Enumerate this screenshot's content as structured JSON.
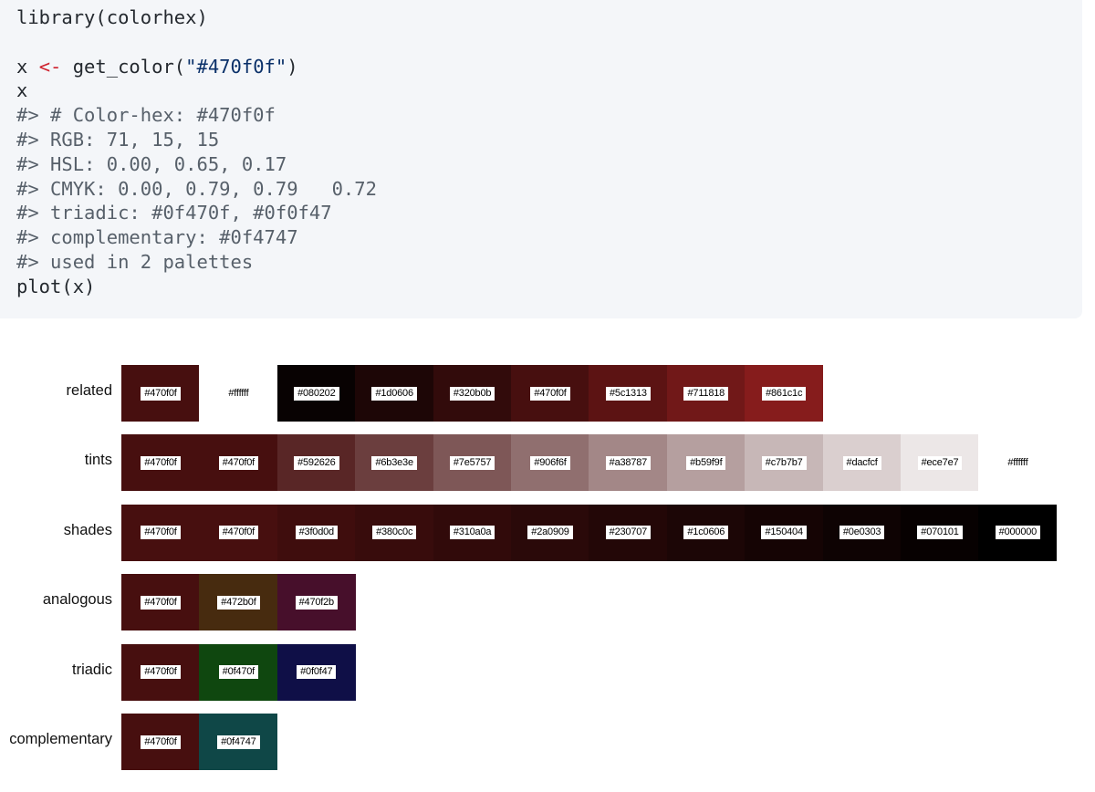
{
  "code": {
    "lines": [
      {
        "text": "library(colorhex)",
        "kind": "code"
      },
      {
        "text": "",
        "kind": "blank"
      },
      {
        "pre": "x ",
        "op": "<-",
        "mid": " get_color(",
        "str": "\"#470f0f\"",
        "post": ")",
        "kind": "assign"
      },
      {
        "text": "x",
        "kind": "code"
      },
      {
        "text": "#> # Color-hex: #470f0f",
        "kind": "comment"
      },
      {
        "text": "#> RGB: 71, 15, 15",
        "kind": "comment"
      },
      {
        "text": "#> HSL: 0.00, 0.65, 0.17",
        "kind": "comment"
      },
      {
        "text": "#> CMYK: 0.00, 0.79, 0.79   0.72",
        "kind": "comment"
      },
      {
        "text": "#> triadic: #0f470f, #0f0f47",
        "kind": "comment"
      },
      {
        "text": "#> complementary: #0f4747",
        "kind": "comment"
      },
      {
        "text": "#> used in 2 palettes",
        "kind": "comment"
      },
      {
        "text": "plot(x)",
        "kind": "code"
      }
    ]
  },
  "plot": {
    "rows": [
      {
        "label": "related",
        "swatches": [
          {
            "hex": "#470f0f",
            "color": "#470f0f",
            "slot": 0
          },
          {
            "hex": "#ffffff",
            "color": "#ffffff",
            "slot": 1
          },
          {
            "hex": "#080202",
            "color": "#080202",
            "slot": 2
          },
          {
            "hex": "#1d0606",
            "color": "#1d0606",
            "slot": 3
          },
          {
            "hex": "#320b0b",
            "color": "#320b0b",
            "slot": 4
          },
          {
            "hex": "#470f0f",
            "color": "#470f0f",
            "slot": 5
          },
          {
            "hex": "#5c1313",
            "color": "#5c1313",
            "slot": 6
          },
          {
            "hex": "#711818",
            "color": "#711818",
            "slot": 7
          },
          {
            "hex": "#861c1c",
            "color": "#861c1c",
            "slot": 8
          }
        ]
      },
      {
        "label": "tints",
        "swatches": [
          {
            "hex": "#470f0f",
            "color": "#470f0f",
            "slot": 0
          },
          {
            "hex": "#470f0f",
            "color": "#470f0f",
            "slot": 1
          },
          {
            "hex": "#592626",
            "color": "#592626",
            "slot": 2
          },
          {
            "hex": "#6b3e3e",
            "color": "#6b3e3e",
            "slot": 3
          },
          {
            "hex": "#7e5757",
            "color": "#7e5757",
            "slot": 4
          },
          {
            "hex": "#906f6f",
            "color": "#906f6f",
            "slot": 5
          },
          {
            "hex": "#a38787",
            "color": "#a38787",
            "slot": 6
          },
          {
            "hex": "#b59f9f",
            "color": "#b59f9f",
            "slot": 7
          },
          {
            "hex": "#c7b7b7",
            "color": "#c7b7b7",
            "slot": 8
          },
          {
            "hex": "#dacfcf",
            "color": "#dacfcf",
            "slot": 9
          },
          {
            "hex": "#ece7e7",
            "color": "#ece7e7",
            "slot": 10
          },
          {
            "hex": "#ffffff",
            "color": "#ffffff",
            "slot": 11
          }
        ]
      },
      {
        "label": "shades",
        "swatches": [
          {
            "hex": "#470f0f",
            "color": "#470f0f",
            "slot": 0
          },
          {
            "hex": "#470f0f",
            "color": "#470f0f",
            "slot": 1
          },
          {
            "hex": "#3f0d0d",
            "color": "#3f0d0d",
            "slot": 2
          },
          {
            "hex": "#380c0c",
            "color": "#380c0c",
            "slot": 3
          },
          {
            "hex": "#310a0a",
            "color": "#310a0a",
            "slot": 4
          },
          {
            "hex": "#2a0909",
            "color": "#2a0909",
            "slot": 5
          },
          {
            "hex": "#230707",
            "color": "#230707",
            "slot": 6
          },
          {
            "hex": "#1c0606",
            "color": "#1c0606",
            "slot": 7
          },
          {
            "hex": "#150404",
            "color": "#150404",
            "slot": 8
          },
          {
            "hex": "#0e0303",
            "color": "#0e0303",
            "slot": 9
          },
          {
            "hex": "#070101",
            "color": "#070101",
            "slot": 10
          },
          {
            "hex": "#000000",
            "color": "#000000",
            "slot": 11
          }
        ]
      },
      {
        "label": "analogous",
        "swatches": [
          {
            "hex": "#470f0f",
            "color": "#470f0f",
            "slot": 0
          },
          {
            "hex": "#472b0f",
            "color": "#472b0f",
            "slot": 1
          },
          {
            "hex": "#470f2b",
            "color": "#470f2b",
            "slot": 2
          }
        ]
      },
      {
        "label": "triadic",
        "swatches": [
          {
            "hex": "#470f0f",
            "color": "#470f0f",
            "slot": 0
          },
          {
            "hex": "#0f470f",
            "color": "#0f470f",
            "slot": 1
          },
          {
            "hex": "#0f0f47",
            "color": "#0f0f47",
            "slot": 2
          }
        ]
      },
      {
        "label": "complementary",
        "swatches": [
          {
            "hex": "#470f0f",
            "color": "#470f0f",
            "slot": 0
          },
          {
            "hex": "#0f4747",
            "color": "#0f4747",
            "slot": 1
          }
        ]
      }
    ]
  }
}
